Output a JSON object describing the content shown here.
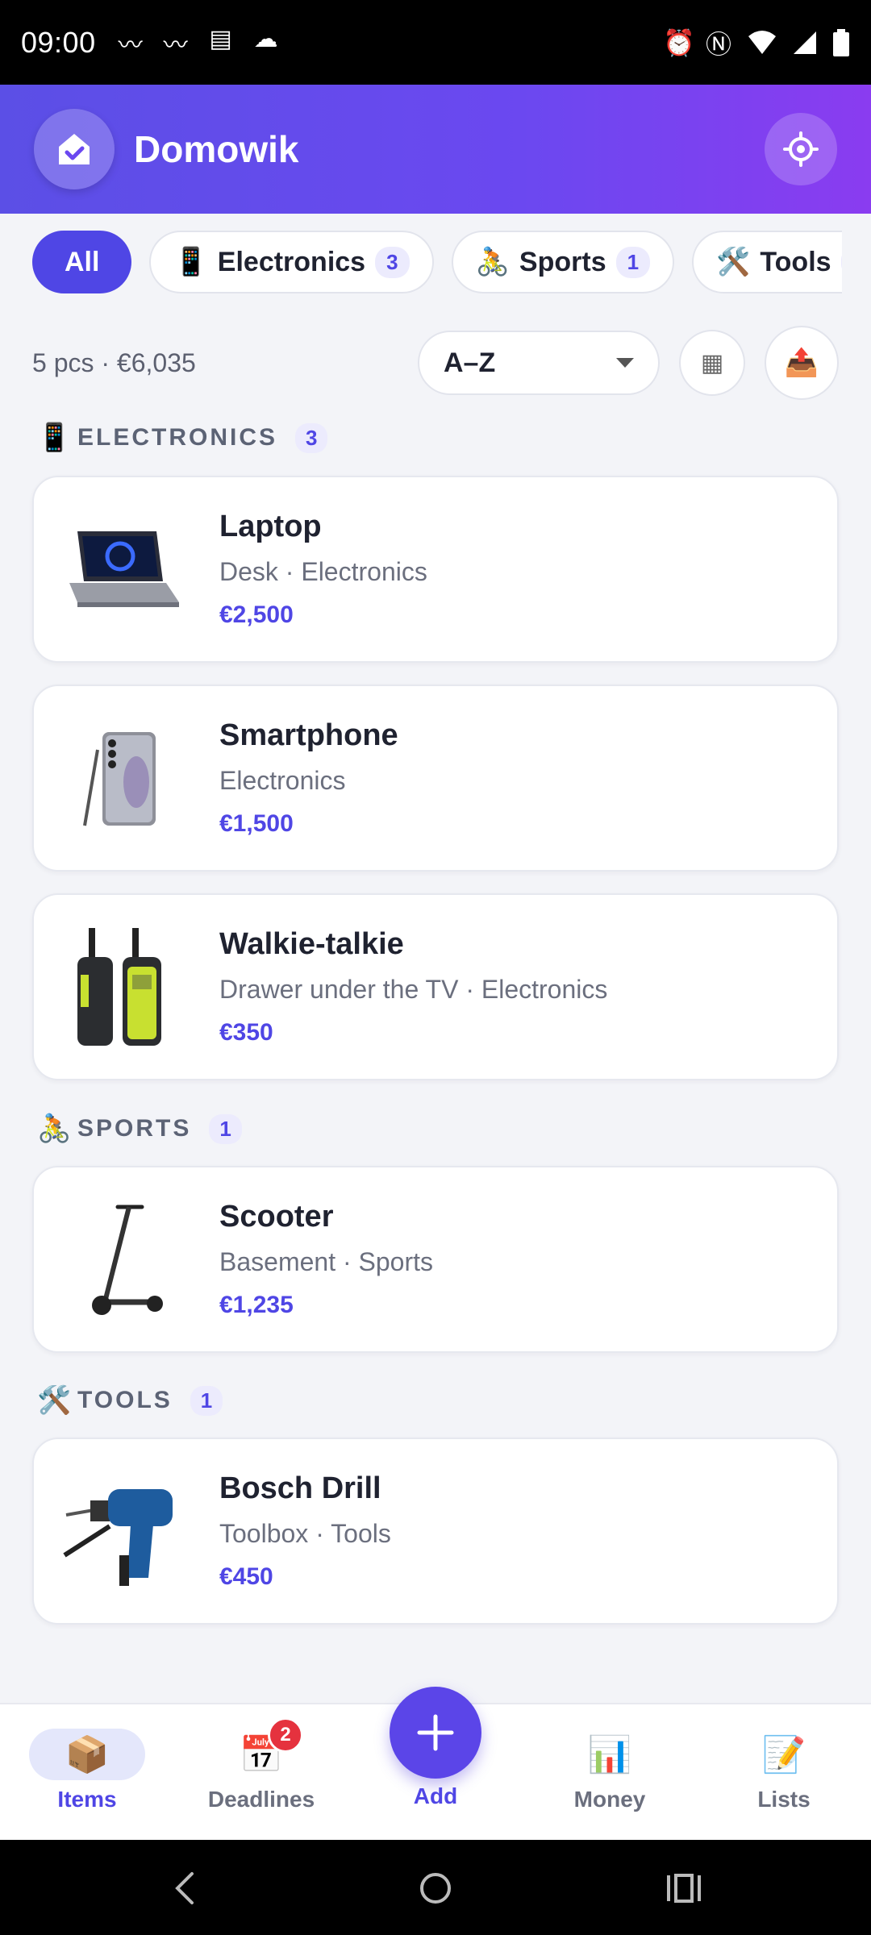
{
  "status_bar": {
    "time": "09:00",
    "left_icons": [
      "signal-app-icon",
      "signal-app-icon",
      "calendar-icon",
      "cloud-icon"
    ],
    "right_icons": [
      "alarm-icon",
      "nfc-icon",
      "wifi-icon",
      "cell-signal-icon",
      "battery-icon"
    ]
  },
  "header": {
    "title": "Domowik",
    "logo_icon": "home-check-icon",
    "settings_icon": "settings-icon"
  },
  "chips": [
    {
      "label": "All",
      "emoji": "",
      "count": "",
      "active": true
    },
    {
      "label": "Electronics",
      "emoji": "📱",
      "count": "3",
      "active": false
    },
    {
      "label": "Sports",
      "emoji": "🚴",
      "count": "1",
      "active": false
    },
    {
      "label": "Tools",
      "emoji": "🛠️",
      "count": "",
      "active": false
    }
  ],
  "summary": {
    "text": "5 pcs · €6,035",
    "sort_value": "A–Z",
    "grid_icon": "▦",
    "export_icon": "📤"
  },
  "sections": [
    {
      "emoji": "📱",
      "label": "ELECTRONICS",
      "count": "3",
      "items": [
        {
          "name": "Laptop",
          "sub": "Desk · Electronics",
          "price": "€2,500",
          "icon": "laptop"
        },
        {
          "name": "Smartphone",
          "sub": "Electronics",
          "price": "€1,500",
          "icon": "smartphone"
        },
        {
          "name": "Walkie-talkie",
          "sub": "Drawer under the TV · Electronics",
          "price": "€350",
          "icon": "walkie-talkie"
        }
      ]
    },
    {
      "emoji": "🚴",
      "label": "SPORTS",
      "count": "1",
      "items": [
        {
          "name": "Scooter",
          "sub": "Basement · Sports",
          "price": "€1,235",
          "icon": "scooter"
        }
      ]
    },
    {
      "emoji": "🛠️",
      "label": "TOOLS",
      "count": "1",
      "items": [
        {
          "name": "Bosch Drill",
          "sub": "Toolbox · Tools",
          "price": "€450",
          "icon": "drill"
        }
      ]
    }
  ],
  "bottom_nav": {
    "items": {
      "label": "Items",
      "emoji": "📦"
    },
    "deadlines": {
      "label": "Deadlines",
      "emoji": "📅",
      "badge": "2"
    },
    "add": {
      "label": "Add"
    },
    "money": {
      "label": "Money",
      "emoji": "📊"
    },
    "lists": {
      "label": "Lists",
      "emoji": "📝"
    }
  },
  "colors": {
    "accent": "#4F46E5",
    "header_start": "#5B4FE6",
    "header_end": "#8A3CF0",
    "badge": "#E5323E"
  }
}
